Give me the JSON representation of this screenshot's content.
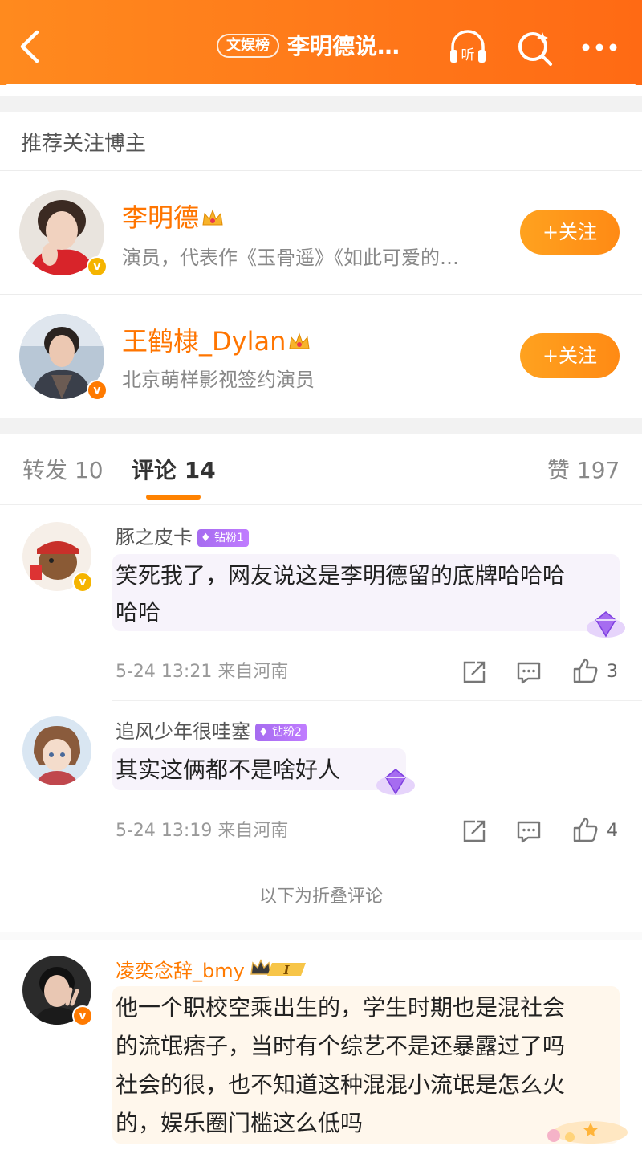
{
  "header": {
    "badge": "文娱榜",
    "title": "李明德说…",
    "listen_label": "听"
  },
  "recommend": {
    "heading": "推荐关注博主",
    "users": [
      {
        "name": "李明德",
        "desc": "演员，代表作《玉骨遥》《如此可爱的…",
        "follow": "+关注"
      },
      {
        "name": "王鹤棣_Dylan",
        "desc": "北京萌样影视签约演员",
        "follow": "+关注"
      }
    ]
  },
  "tabs": {
    "repost": "转发 10",
    "comment": "评论 14",
    "like": "赞 197"
  },
  "comments": [
    {
      "name": "豚之皮卡",
      "fan_badge": "钻粉1",
      "text_line1": "笑死我了，网友说这是李明德留的底牌哈哈哈",
      "text_line2": "哈哈",
      "meta": "5-24 13:21 来自河南",
      "likes": "3"
    },
    {
      "name": "追风少年很哇塞",
      "fan_badge": "钻粉2",
      "text_line1": "其实这俩都不是啥好人",
      "meta": "5-24 13:19 来自河南",
      "likes": "4"
    },
    {
      "name": "凌奕念辞_bmy",
      "level": "I",
      "text_line1": "他一个职校空乘出生的，学生时期也是混社会",
      "text_line2": "的流氓痞子，当时有个综艺不是还暴露过了吗",
      "text_line3": "社会的很，也不知道这种混混小流氓是怎么火",
      "text_line4": "的，娱乐圈门槛这么低吗"
    }
  ],
  "folded_notice": "以下为折叠评论",
  "colors": {
    "brand_orange": "#ff8200",
    "fan_purple": "#a66cf0"
  }
}
